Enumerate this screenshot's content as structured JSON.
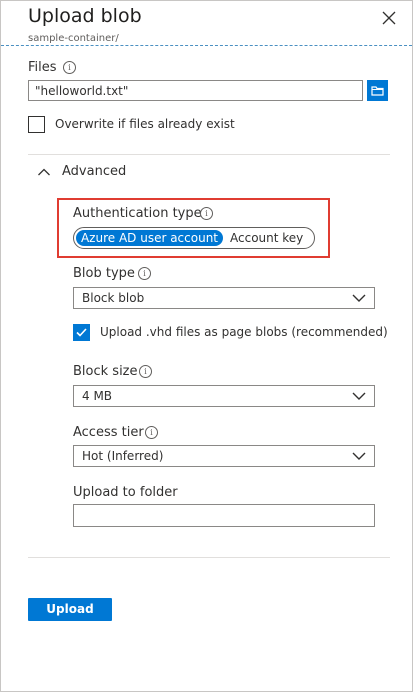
{
  "header": {
    "title": "Upload blob",
    "subtitle": "sample-container/"
  },
  "files": {
    "label": "Files",
    "value": "\"helloworld.txt\"",
    "overwrite_label": "Overwrite if files already exist",
    "overwrite_checked": false
  },
  "advanced": {
    "label": "Advanced",
    "expanded": true
  },
  "auth": {
    "label": "Authentication type",
    "options": [
      "Azure AD user account",
      "Account key"
    ],
    "selected": "Azure AD user account"
  },
  "blob_type": {
    "label": "Blob type",
    "value": "Block blob",
    "vhd_label": "Upload .vhd files as page blobs (recommended)",
    "vhd_checked": true
  },
  "block_size": {
    "label": "Block size",
    "value": "4 MB"
  },
  "access_tier": {
    "label": "Access tier",
    "value": "Hot (Inferred)"
  },
  "upload_folder": {
    "label": "Upload to folder",
    "value": ""
  },
  "actions": {
    "upload_label": "Upload"
  },
  "colors": {
    "accent": "#0078d4",
    "highlight": "#e03c31"
  }
}
